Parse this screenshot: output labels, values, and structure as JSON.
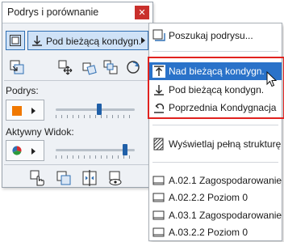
{
  "palette": {
    "title": "Podrys i porównanie",
    "close_glyph": "✕",
    "mode_select_label": "Pod bieżącą kondygn.",
    "sections": {
      "trace_label": "Podrys:",
      "active_view_label": "Aktywny Widok:"
    },
    "trace_color": "#f07800",
    "trace_slider_level": 0.55,
    "active_slider_level": 0.9
  },
  "menu": {
    "items": [
      {
        "label": "Poszukaj podrysu...",
        "icon": "find-trace-icon"
      },
      {
        "label": "Nad bieżącą kondygn.",
        "icon": "story-above-icon",
        "selected": true
      },
      {
        "label": "Pod bieżącą kondygn.",
        "icon": "story-below-icon"
      },
      {
        "label": "Poprzednia Kondygnacja",
        "icon": "previous-story-icon"
      },
      {
        "label": "Wyświetlaj pełną strukturę",
        "icon": "full-structure-icon"
      },
      {
        "label": "A.02.1 Zagospodarowanie",
        "icon": "view-icon"
      },
      {
        "label": "A.02.2.2 Poziom 0",
        "icon": "view-icon"
      },
      {
        "label": "A.03.1 Zagospodarowanie",
        "icon": "view-icon"
      },
      {
        "label": "A.03.2.2 Poziom 0",
        "icon": "view-icon"
      }
    ]
  },
  "colors": {
    "accent": "#2a72c9",
    "highlight_box": "#e0221f",
    "close_button": "#c9302c"
  }
}
